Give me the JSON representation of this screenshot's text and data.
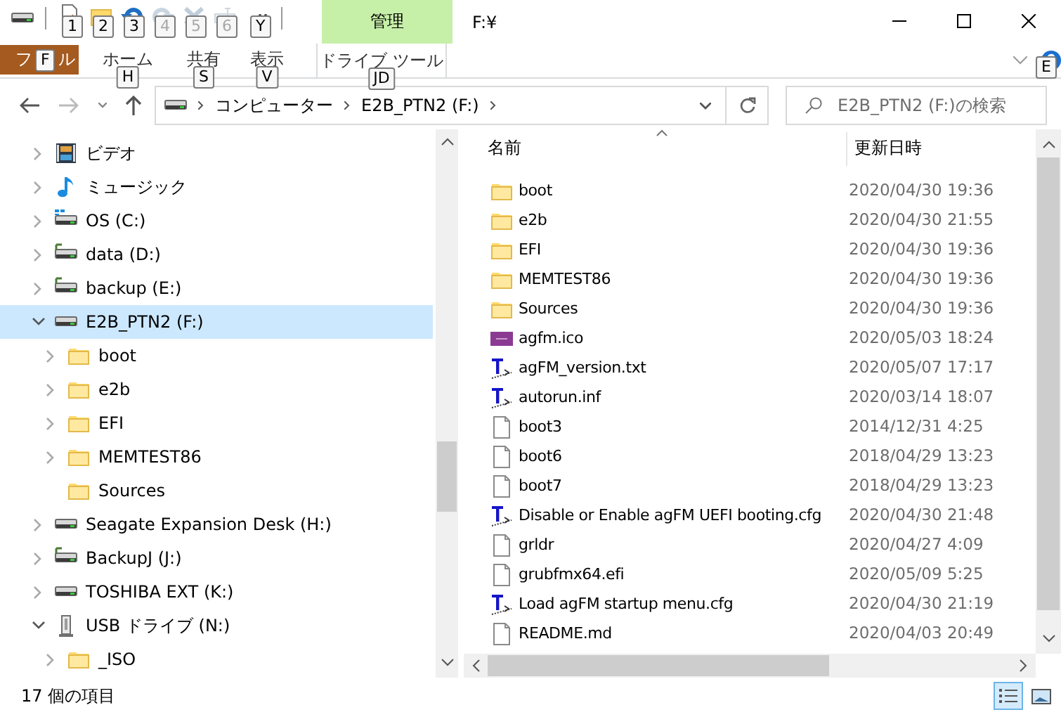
{
  "window": {
    "title": "F:¥"
  },
  "quick_access": [
    {
      "kind": "properties",
      "keytip": "1",
      "disabled": false
    },
    {
      "kind": "new-folder",
      "keytip": "2",
      "disabled": false
    },
    {
      "kind": "undo",
      "keytip": "3",
      "disabled": false
    },
    {
      "kind": "redo",
      "keytip": "4",
      "disabled": true
    },
    {
      "kind": "delete",
      "keytip": "5",
      "disabled": true
    },
    {
      "kind": "rename",
      "keytip": "6",
      "disabled": true
    }
  ],
  "customize_keytip": "Y",
  "ribbon": {
    "file_tab": {
      "label_parts": [
        "フ",
        "ル"
      ],
      "keytip": "F"
    },
    "tabs": [
      {
        "label": "ホーム",
        "keytip": "H"
      },
      {
        "label": "共有",
        "keytip": "S"
      },
      {
        "label": "表示",
        "keytip": "V"
      }
    ],
    "context_group": {
      "label": "管理",
      "tab": {
        "label": "ドライブ ツール",
        "keytip": "JD"
      }
    },
    "help_keytip": "E"
  },
  "address": {
    "crumbs": [
      "コンピューター",
      "E2B_PTN2 (F:)"
    ]
  },
  "search": {
    "placeholder": "E2B_PTN2 (F:)の検索"
  },
  "nav": [
    {
      "label": "ビデオ",
      "kind": "video",
      "expandable": true,
      "expanded": false,
      "selected": false
    },
    {
      "label": "ミュージック",
      "kind": "music",
      "expandable": true,
      "expanded": false,
      "selected": false
    },
    {
      "label": "OS (C:)",
      "kind": "os-drive",
      "expandable": true,
      "expanded": false,
      "selected": false
    },
    {
      "label": "data (D:)",
      "kind": "net-drive",
      "expandable": true,
      "expanded": false,
      "selected": false
    },
    {
      "label": "backup (E:)",
      "kind": "net-drive",
      "expandable": true,
      "expanded": false,
      "selected": false
    },
    {
      "label": "E2B_PTN2 (F:)",
      "kind": "drive",
      "expandable": true,
      "expanded": true,
      "selected": true,
      "children": [
        {
          "label": "boot",
          "kind": "folder",
          "expandable": true,
          "expanded": false,
          "selected": false
        },
        {
          "label": "e2b",
          "kind": "folder",
          "expandable": true,
          "expanded": false,
          "selected": false
        },
        {
          "label": "EFI",
          "kind": "folder",
          "expandable": true,
          "expanded": false,
          "selected": false
        },
        {
          "label": "MEMTEST86",
          "kind": "folder",
          "expandable": true,
          "expanded": false,
          "selected": false
        },
        {
          "label": "Sources",
          "kind": "folder",
          "expandable": false,
          "expanded": false,
          "selected": false
        }
      ]
    },
    {
      "label": "Seagate Expansion Desk (H:)",
      "kind": "drive",
      "expandable": true,
      "expanded": false,
      "selected": false
    },
    {
      "label": "BackupJ (J:)",
      "kind": "net-drive",
      "expandable": true,
      "expanded": false,
      "selected": false
    },
    {
      "label": "TOSHIBA EXT (K:)",
      "kind": "drive",
      "expandable": true,
      "expanded": false,
      "selected": false
    },
    {
      "label": "USB ドライブ (N:)",
      "kind": "usb",
      "expandable": true,
      "expanded": true,
      "selected": false,
      "children": [
        {
          "label": "_ISO",
          "kind": "folder",
          "expandable": true,
          "expanded": false,
          "selected": false
        }
      ]
    }
  ],
  "files": {
    "columns": [
      "名前",
      "更新日時"
    ],
    "rows": [
      {
        "name": "boot",
        "kind": "folder",
        "modified": "2020/04/30 19:36"
      },
      {
        "name": "e2b",
        "kind": "folder",
        "modified": "2020/04/30 21:55"
      },
      {
        "name": "EFI",
        "kind": "folder",
        "modified": "2020/04/30 19:36"
      },
      {
        "name": "MEMTEST86",
        "kind": "folder",
        "modified": "2020/04/30 19:36"
      },
      {
        "name": "Sources",
        "kind": "folder",
        "modified": "2020/04/30 19:36"
      },
      {
        "name": "agfm.ico",
        "kind": "image",
        "modified": "2020/05/03 18:24"
      },
      {
        "name": "agFM_version.txt",
        "kind": "text",
        "modified": "2020/05/07 17:17"
      },
      {
        "name": "autorun.inf",
        "kind": "text",
        "modified": "2020/03/14 18:07"
      },
      {
        "name": "boot3",
        "kind": "file",
        "modified": "2014/12/31 4:25"
      },
      {
        "name": "boot6",
        "kind": "file",
        "modified": "2018/04/29 13:23"
      },
      {
        "name": "boot7",
        "kind": "file",
        "modified": "2018/04/29 13:23"
      },
      {
        "name": "Disable or Enable agFM UEFI booting.cfg",
        "kind": "text",
        "modified": "2020/04/30 21:48"
      },
      {
        "name": "grldr",
        "kind": "file",
        "modified": "2020/04/27 4:09"
      },
      {
        "name": "grubfmx64.efi",
        "kind": "file",
        "modified": "2020/05/09 5:25"
      },
      {
        "name": "Load agFM startup menu.cfg",
        "kind": "text",
        "modified": "2020/04/30 21:19"
      },
      {
        "name": "README.md",
        "kind": "file",
        "modified": "2020/04/03 20:49"
      }
    ]
  },
  "status_bar": {
    "item_count": "17 個の項目"
  }
}
